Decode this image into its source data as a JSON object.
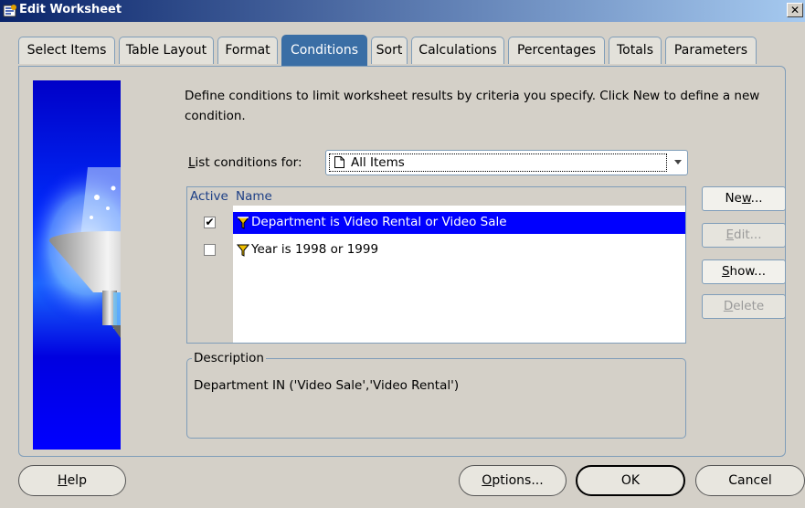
{
  "window": {
    "title": "Edit Worksheet",
    "close_label": "✕"
  },
  "tabs": [
    {
      "label": "Select Items"
    },
    {
      "label": "Table Layout"
    },
    {
      "label": "Format"
    },
    {
      "label": "Conditions",
      "active": true
    },
    {
      "label": "Sort"
    },
    {
      "label": "Calculations"
    },
    {
      "label": "Percentages"
    },
    {
      "label": "Totals"
    },
    {
      "label": "Parameters"
    }
  ],
  "intro": "Define conditions to limit worksheet results by criteria you specify. Click New to define a new condition.",
  "list_for": {
    "label_mnemonic": "L",
    "label_rest": "ist conditions for:",
    "value": "All Items"
  },
  "grid": {
    "headers": {
      "active": "Active",
      "name": "Name"
    },
    "rows": [
      {
        "checked": "✔",
        "name": "Department is Video Rental or Video Sale",
        "selected": true
      },
      {
        "checked": "",
        "name": "Year is 1998 or 1999",
        "selected": false
      }
    ]
  },
  "description": {
    "legend": "Description",
    "text": "Department IN ('Video Sale','Video Rental')"
  },
  "side_buttons": {
    "new": {
      "pre": "Ne",
      "mn": "w",
      "post": "...",
      "enabled": true
    },
    "edit": {
      "pre": "",
      "mn": "E",
      "post": "dit...",
      "enabled": false
    },
    "show": {
      "pre": "",
      "mn": "S",
      "post": "how...",
      "enabled": true
    },
    "delete": {
      "pre": "",
      "mn": "D",
      "post": "elete",
      "enabled": false
    }
  },
  "footer": {
    "help": {
      "mn": "H",
      "post": "elp"
    },
    "options": {
      "mn": "O",
      "post": "ptions..."
    },
    "ok": {
      "label": "OK"
    },
    "cancel": {
      "label": "Cancel"
    }
  },
  "colors": {
    "selection": "#0000ff",
    "active_tab": "#3a6ea5",
    "sidebar": "#0000ff"
  }
}
